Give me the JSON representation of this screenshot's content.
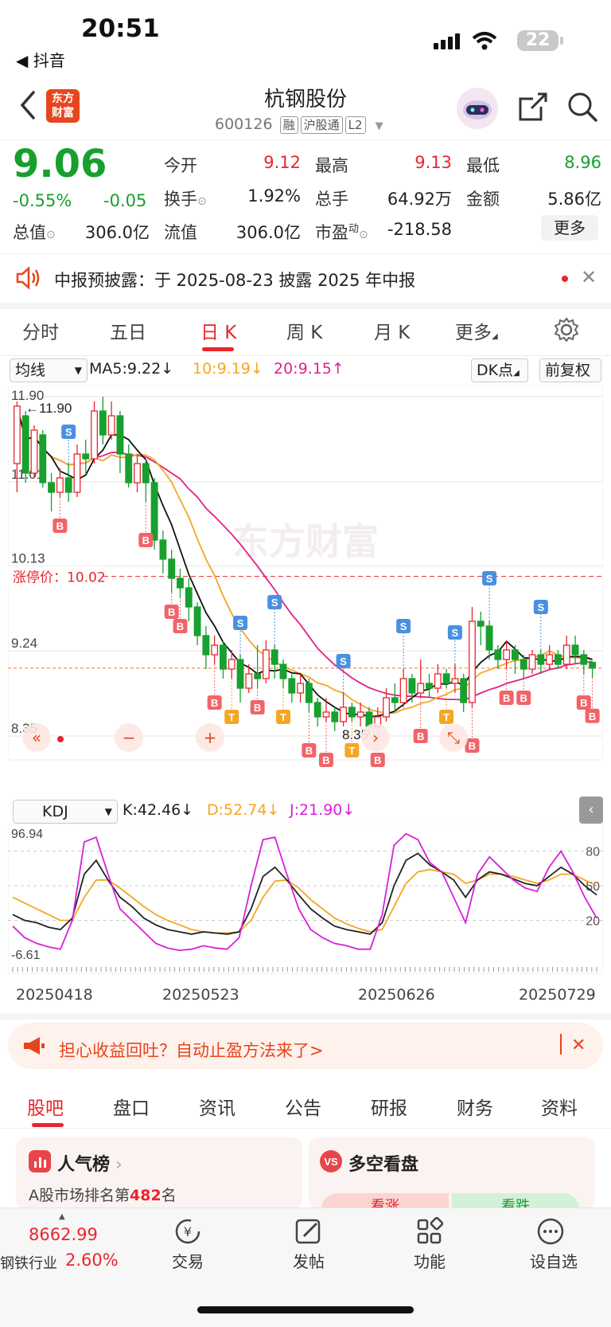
{
  "status_bar": {
    "time": "20:51",
    "back_app": "◀ 抖音",
    "battery": "22"
  },
  "header": {
    "logo_text_1": "东方",
    "logo_text_2": "财富",
    "stock_name": "杭钢股份",
    "code": "600126",
    "tags": [
      "融",
      "沪股通",
      "L2"
    ]
  },
  "quote": {
    "price": "9.06",
    "change_pct": "-0.55%",
    "change_abs": "-0.05",
    "fields": {
      "open_label": "今开",
      "open": "9.12",
      "high_label": "最高",
      "high": "9.13",
      "low_label": "最低",
      "low": "8.96",
      "turnover_label": "换手",
      "turnover": "1.92%",
      "volume_label": "总手",
      "volume": "64.92万",
      "amount_label": "金额",
      "amount": "5.86亿",
      "mktcap_label": "总值",
      "mktcap": "306.0亿",
      "float_label": "流值",
      "float": "306.0亿",
      "pe_label": "市盈",
      "pe_sup": "动",
      "pe": "-218.58"
    },
    "more_button": "更多"
  },
  "notice": {
    "text": "中报预披露：于 2025-08-23 披露 2025 年中报"
  },
  "tabs": [
    "分时",
    "五日",
    "日 K",
    "周 K",
    "月 K",
    "更多"
  ],
  "active_tab": "日 K",
  "toolbar": {
    "indicator": "均线",
    "ma5": "MA5:9.22",
    "ma10": "10:9.19",
    "ma20": "20:9.15",
    "dk": "DK点",
    "adjust": "前复权"
  },
  "colors": {
    "up": "#e8262d",
    "down": "#17a02e",
    "ma5": "#111111",
    "ma10": "#f5a623",
    "ma20": "#e0218a",
    "accent": "#e5461d"
  },
  "chart_data": {
    "type": "candlestick",
    "y_axis_labels": [
      "11.90",
      "11.01",
      "10.13",
      "9.24",
      "8.35"
    ],
    "ylim": [
      8.35,
      11.9
    ],
    "high_marker": "11.90",
    "low_marker": "8.35",
    "limit_label": "涨停价：10.02",
    "limit_value": 10.02,
    "last_close_line": 9.06,
    "watermark": "东方财富",
    "x_labels": [
      "20250418",
      "20250523",
      "20250626",
      "20250729"
    ],
    "candles": [
      [
        11.2,
        11.8,
        11.85,
        10.9
      ],
      [
        11.7,
        11.1,
        11.75,
        11.0
      ],
      [
        11.1,
        11.55,
        11.6,
        11.05
      ],
      [
        11.5,
        11.0,
        11.55,
        10.95
      ],
      [
        11.0,
        10.9,
        11.1,
        10.7
      ],
      [
        10.9,
        11.05,
        11.15,
        10.85
      ],
      [
        11.05,
        10.9,
        11.2,
        10.8
      ],
      [
        10.9,
        11.3,
        11.4,
        10.85
      ],
      [
        11.3,
        11.25,
        11.45,
        11.1
      ],
      [
        11.25,
        11.75,
        11.85,
        11.2
      ],
      [
        11.75,
        11.5,
        11.9,
        11.4
      ],
      [
        11.5,
        11.7,
        11.85,
        11.45
      ],
      [
        11.7,
        11.3,
        11.75,
        11.1
      ],
      [
        11.3,
        11.0,
        11.4,
        10.95
      ],
      [
        11.0,
        11.2,
        11.3,
        10.9
      ],
      [
        11.2,
        11.0,
        11.25,
        10.8
      ],
      [
        11.0,
        10.4,
        11.05,
        10.3
      ],
      [
        10.4,
        10.2,
        10.5,
        10.05
      ],
      [
        10.2,
        10.0,
        10.3,
        9.85
      ],
      [
        10.0,
        9.9,
        10.1,
        9.8
      ],
      [
        9.9,
        9.7,
        10.0,
        9.55
      ],
      [
        9.7,
        9.4,
        9.75,
        9.3
      ],
      [
        9.4,
        9.2,
        9.5,
        9.05
      ],
      [
        9.2,
        9.3,
        9.4,
        9.1
      ],
      [
        9.3,
        9.05,
        9.35,
        8.95
      ],
      [
        9.05,
        9.15,
        9.25,
        8.95
      ],
      [
        9.15,
        8.85,
        9.2,
        8.7
      ],
      [
        8.85,
        9.0,
        9.1,
        8.8
      ],
      [
        9.0,
        8.95,
        9.3,
        8.85
      ],
      [
        8.95,
        9.25,
        9.35,
        8.9
      ],
      [
        9.25,
        9.1,
        9.3,
        8.95
      ],
      [
        9.1,
        8.95,
        9.15,
        8.85
      ],
      [
        8.95,
        8.8,
        9.0,
        8.7
      ],
      [
        8.8,
        8.9,
        9.0,
        8.7
      ],
      [
        8.9,
        8.7,
        8.95,
        8.6
      ],
      [
        8.7,
        8.55,
        8.75,
        8.45
      ],
      [
        8.55,
        8.6,
        8.75,
        8.5
      ],
      [
        8.6,
        8.5,
        8.65,
        8.4
      ],
      [
        8.5,
        8.65,
        8.8,
        8.45
      ],
      [
        8.65,
        8.55,
        8.7,
        8.5
      ],
      [
        8.55,
        8.6,
        8.7,
        8.45
      ],
      [
        8.6,
        8.45,
        8.65,
        8.35
      ],
      [
        8.45,
        8.55,
        8.65,
        8.4
      ],
      [
        8.55,
        8.75,
        8.85,
        8.5
      ],
      [
        8.75,
        8.7,
        8.9,
        8.6
      ],
      [
        8.7,
        8.95,
        9.05,
        8.65
      ],
      [
        8.95,
        8.8,
        9.0,
        8.7
      ],
      [
        8.8,
        8.9,
        9.15,
        8.75
      ],
      [
        8.9,
        8.85,
        9.0,
        8.75
      ],
      [
        8.85,
        9.0,
        9.1,
        8.8
      ],
      [
        9.0,
        8.9,
        9.05,
        8.85
      ],
      [
        8.9,
        8.95,
        9.1,
        8.8
      ],
      [
        8.95,
        8.7,
        9.0,
        8.6
      ],
      [
        8.7,
        9.55,
        9.7,
        8.65
      ],
      [
        9.55,
        9.5,
        9.65,
        9.3
      ],
      [
        9.5,
        9.25,
        9.55,
        9.15
      ],
      [
        9.25,
        9.15,
        9.3,
        9.05
      ],
      [
        9.15,
        9.25,
        9.35,
        9.05
      ],
      [
        9.25,
        9.15,
        9.3,
        9.0
      ],
      [
        9.15,
        9.05,
        9.2,
        8.95
      ],
      [
        9.05,
        9.2,
        9.25,
        9.0
      ],
      [
        9.2,
        9.1,
        9.25,
        9.0
      ],
      [
        9.1,
        9.2,
        9.3,
        9.05
      ],
      [
        9.2,
        9.1,
        9.25,
        9.05
      ],
      [
        9.1,
        9.3,
        9.4,
        9.05
      ],
      [
        9.3,
        9.2,
        9.4,
        9.1
      ],
      [
        9.2,
        9.1,
        9.25,
        9.0
      ],
      [
        9.12,
        9.06,
        9.13,
        8.96
      ]
    ],
    "signals": [
      {
        "type": "S",
        "i": 6
      },
      {
        "type": "B",
        "i": 5
      },
      {
        "type": "B",
        "i": 15
      },
      {
        "type": "B",
        "i": 18
      },
      {
        "type": "B",
        "i": 19
      },
      {
        "type": "B",
        "i": 23
      },
      {
        "type": "S",
        "i": 26
      },
      {
        "type": "S",
        "i": 30
      },
      {
        "type": "T",
        "i": 25
      },
      {
        "type": "B",
        "i": 28
      },
      {
        "type": "T",
        "i": 31
      },
      {
        "type": "B",
        "i": 34
      },
      {
        "type": "S",
        "i": 38
      },
      {
        "type": "T",
        "i": 39
      },
      {
        "type": "B",
        "i": 36
      },
      {
        "type": "S",
        "i": 45
      },
      {
        "type": "B",
        "i": 42
      },
      {
        "type": "B",
        "i": 47
      },
      {
        "type": "S",
        "i": 51
      },
      {
        "type": "T",
        "i": 50
      },
      {
        "type": "B",
        "i": 53
      },
      {
        "type": "S",
        "i": 55
      },
      {
        "type": "B",
        "i": 57
      },
      {
        "type": "S",
        "i": 61
      },
      {
        "type": "B",
        "i": 59
      },
      {
        "type": "B",
        "i": 66
      },
      {
        "type": "B",
        "i": 67
      }
    ]
  },
  "kdj": {
    "selector": "KDJ",
    "k": "K:42.46",
    "d": "D:52.74",
    "j": "J:21.90",
    "top": "96.94",
    "bottom": "-6.61",
    "levels": [
      "80",
      "50",
      "20"
    ],
    "k_values": [
      25,
      20,
      18,
      14,
      12,
      22,
      60,
      72,
      55,
      40,
      32,
      22,
      16,
      12,
      10,
      8,
      10,
      9,
      8,
      10,
      30,
      58,
      66,
      55,
      42,
      30,
      22,
      15,
      12,
      10,
      8,
      18,
      50,
      72,
      78,
      68,
      62,
      55,
      40,
      55,
      62,
      60,
      56,
      52,
      50,
      58,
      66,
      60,
      50,
      42
    ],
    "d_values": [
      40,
      35,
      30,
      25,
      20,
      20,
      40,
      55,
      55,
      48,
      40,
      32,
      25,
      20,
      16,
      12,
      10,
      9,
      9,
      10,
      20,
      40,
      54,
      55,
      48,
      38,
      30,
      22,
      17,
      13,
      10,
      12,
      32,
      52,
      62,
      64,
      62,
      60,
      52,
      55,
      60,
      60,
      58,
      55,
      52,
      55,
      60,
      60,
      55,
      50
    ],
    "j_values": [
      15,
      5,
      0,
      -3,
      -5,
      20,
      88,
      92,
      60,
      30,
      20,
      10,
      0,
      -4,
      -6,
      -5,
      -2,
      -4,
      -5,
      5,
      50,
      90,
      92,
      60,
      30,
      12,
      5,
      0,
      -2,
      -5,
      -5,
      25,
      85,
      95,
      90,
      70,
      62,
      40,
      18,
      60,
      75,
      65,
      55,
      48,
      45,
      66,
      80,
      62,
      40,
      22
    ]
  },
  "banner": {
    "text": "担心收益回吐？自动止盈方法来了>"
  },
  "subtabs": [
    "股吧",
    "盘口",
    "资讯",
    "公告",
    "研报",
    "财务",
    "资料"
  ],
  "cards": {
    "rank_title": "人气榜",
    "rank_text": "A股市场排名第",
    "rank_num": "482",
    "rank_unit": "名",
    "vs_title": "多空看盘",
    "bull": "看涨",
    "bear": "看跌"
  },
  "bottom_nav": {
    "index_value": "8662.99",
    "index_name": "钢铁行业",
    "index_pct": "2.60%",
    "items": [
      "交易",
      "发帖",
      "功能",
      "设自选"
    ]
  }
}
